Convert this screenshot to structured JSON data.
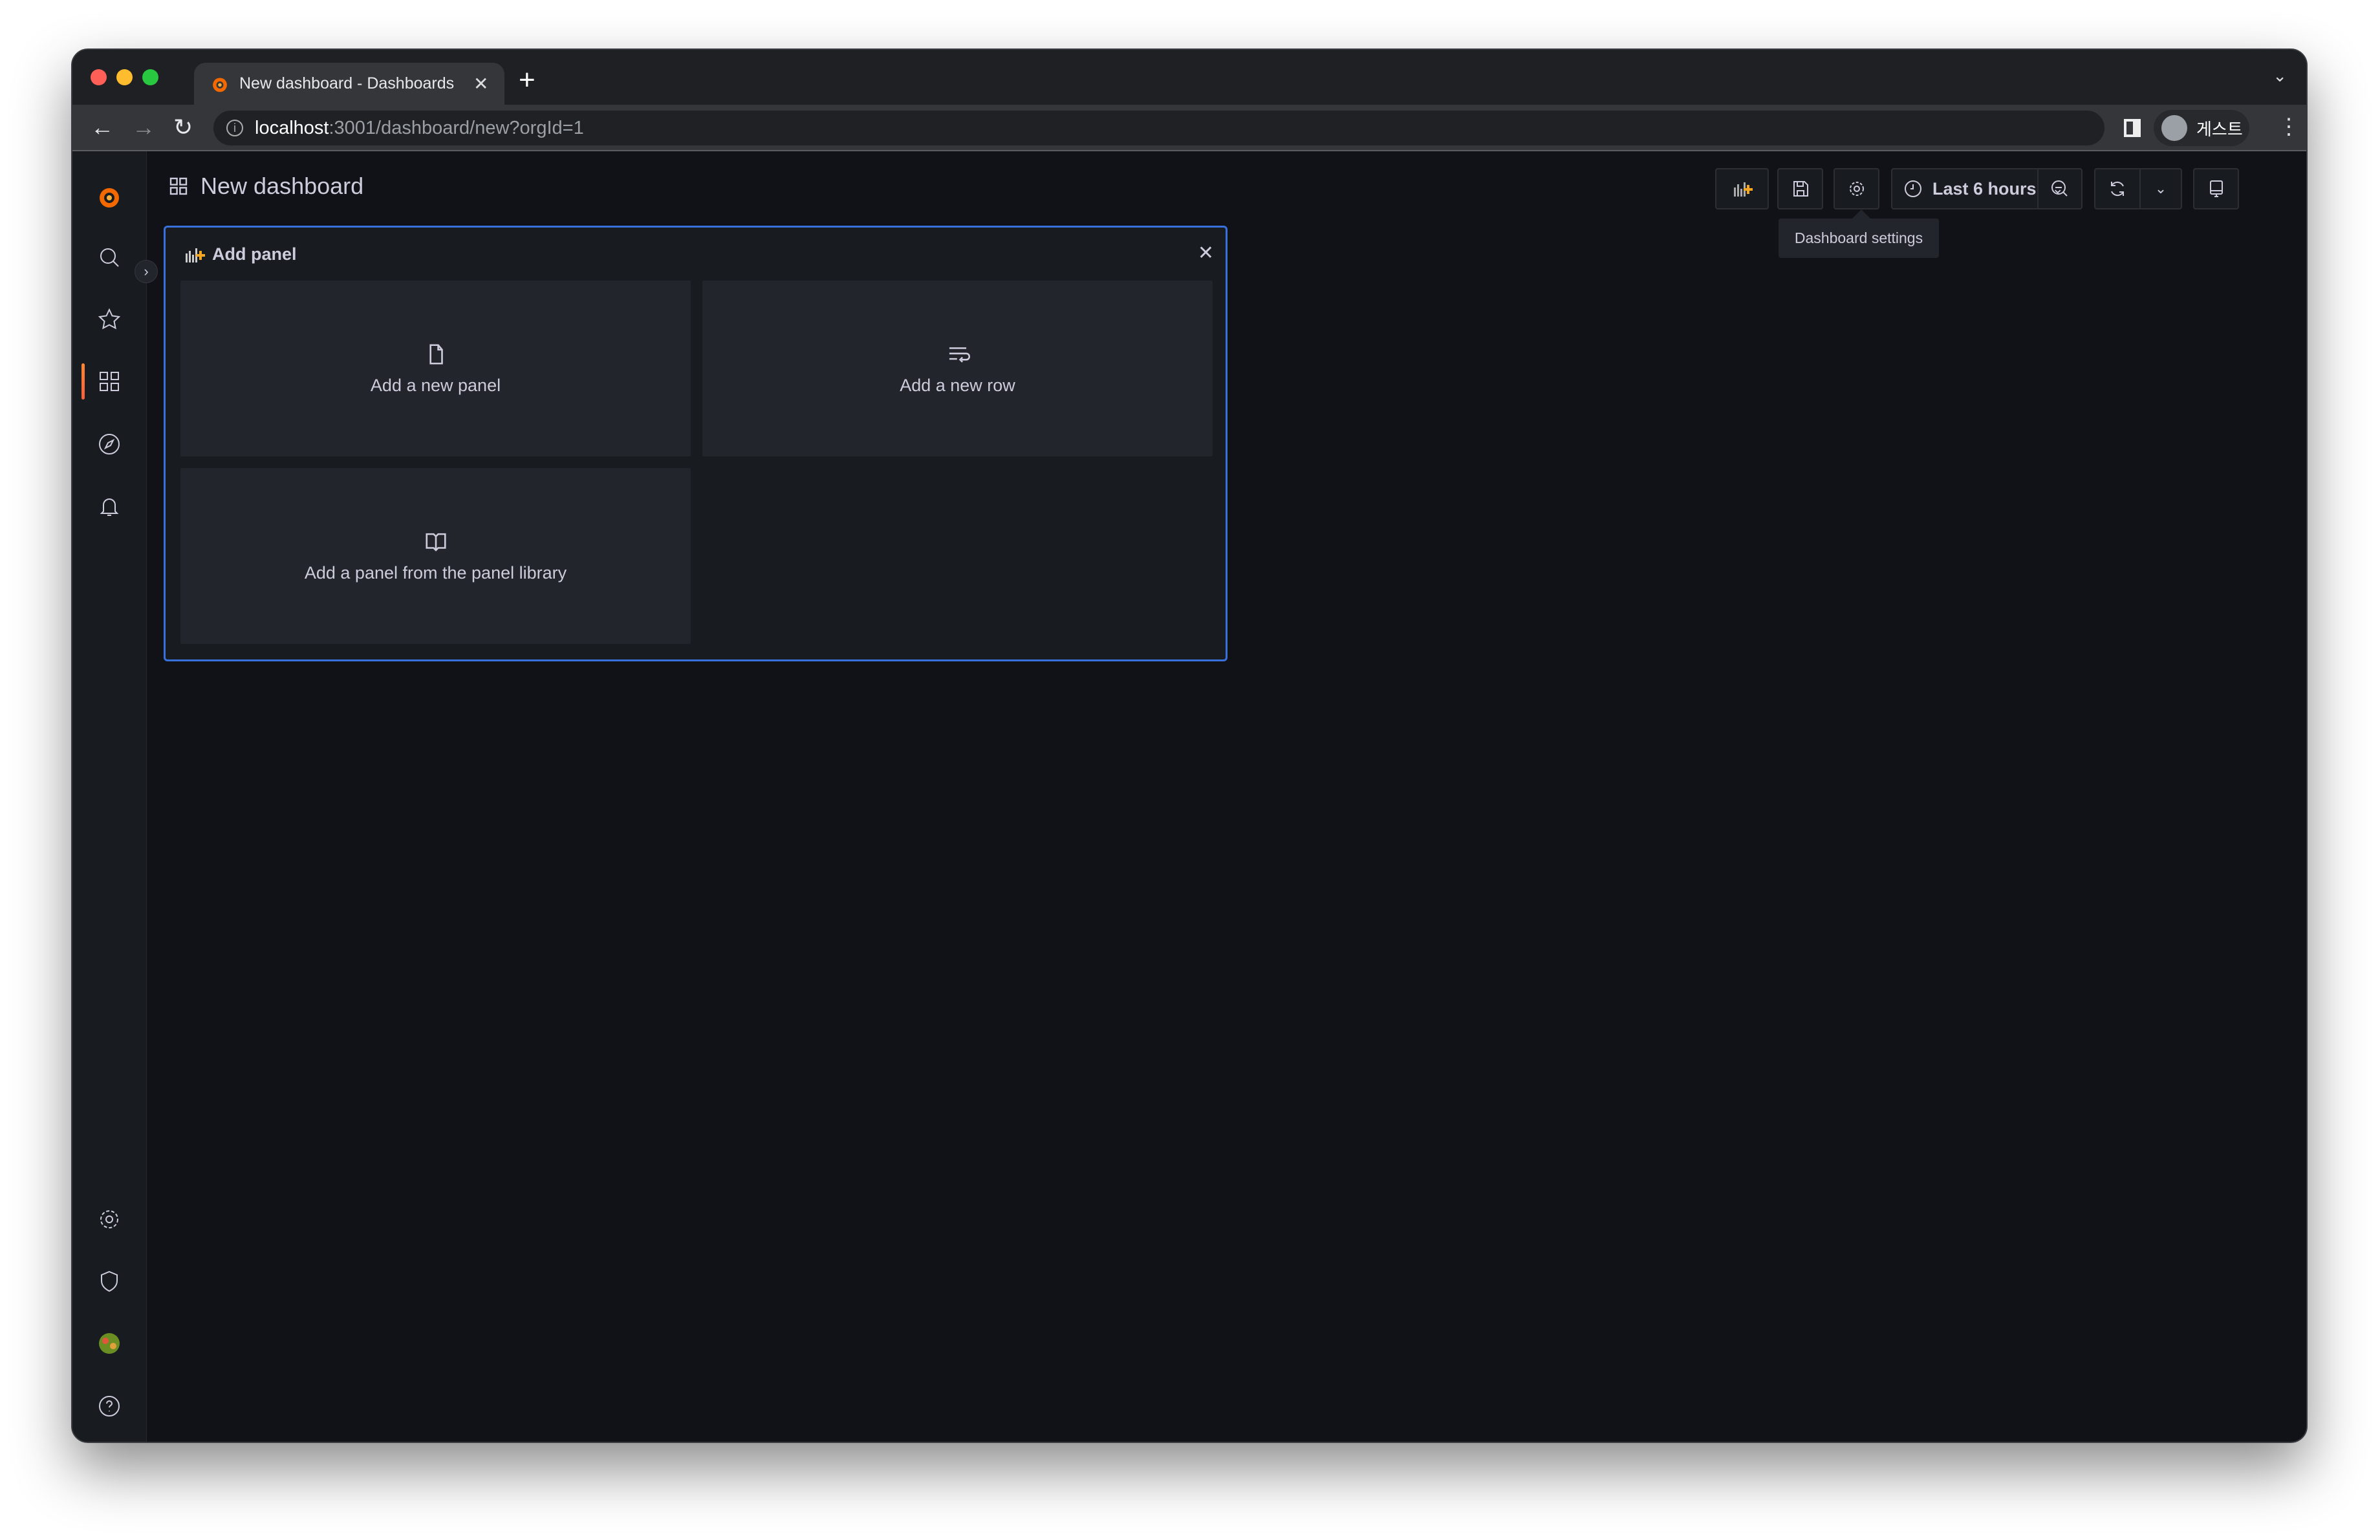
{
  "browser": {
    "tab_title": "New dashboard - Dashboards - Grafana",
    "url_host": "localhost",
    "url_path": ":3001/dashboard/new?orgId=1",
    "profile_label": "게스트",
    "traffic_lights": [
      "#ff5f57",
      "#febc2e",
      "#28c840"
    ]
  },
  "sidebar": {
    "items": [
      "grafana-logo",
      "search",
      "starred",
      "dashboards",
      "explore",
      "alerting",
      "configuration",
      "server-admin",
      "user-avatar",
      "help"
    ],
    "active": "dashboards",
    "accent": "#ff8833"
  },
  "header": {
    "title": "New dashboard"
  },
  "toolbar": {
    "time_range": "Last 6 hours",
    "tooltip": "Dashboard settings"
  },
  "add_panel": {
    "title": "Add panel",
    "options": [
      {
        "label": "Add a new panel",
        "icon": "file-icon"
      },
      {
        "label": "Add a new row",
        "icon": "row-icon"
      },
      {
        "label": "Add a panel from the panel library",
        "icon": "book-icon"
      }
    ],
    "border_color": "#3871dc"
  }
}
